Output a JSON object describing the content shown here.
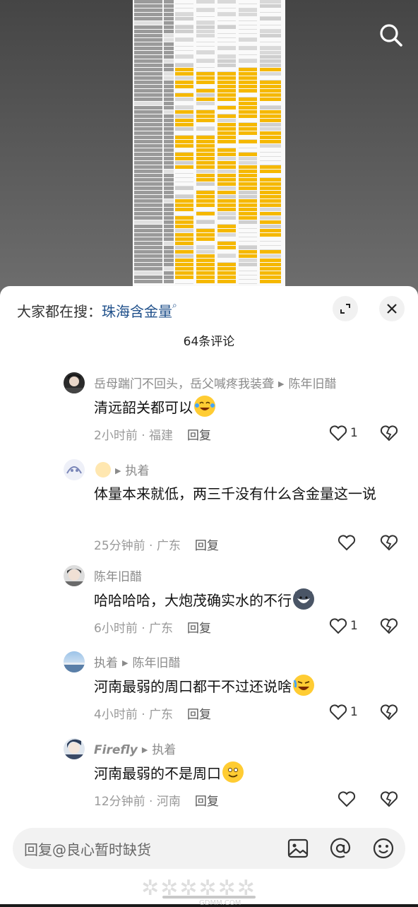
{
  "top": {
    "search_icon": "search-icon"
  },
  "sheet": {
    "trending_prefix": "大家都在搜：",
    "trending_keyword": "珠海含金量",
    "comment_count": "64条评论",
    "comments": [
      {
        "author": "岳母踹门不回头，岳父喊疼我装聋",
        "reply_to": "陈年旧醋",
        "text": "清远韶关都可以",
        "emoji": "laugh-tear-emoji",
        "time_loc": "2小时前 · 福建",
        "reply": "回复",
        "likes": "1"
      },
      {
        "author": "",
        "reply_to": "执着",
        "text": "体量本来就低，两三千没有什么含金量这一说",
        "emoji": "",
        "time_loc": "25分钟前 · 广东",
        "reply": "回复",
        "likes": ""
      },
      {
        "author": "陈年旧醋",
        "reply_to": "",
        "text": "哈哈哈哈，大炮茂确实水的不行",
        "emoji": "husky-emoji",
        "time_loc": "6小时前 · 广东",
        "reply": "回复",
        "likes": "1"
      },
      {
        "author": "执着",
        "reply_to": "陈年旧醋",
        "text": "河南最弱的周口都干不过还说啥",
        "emoji": "rofl-emoji",
        "time_loc": "4小时前 · 广东",
        "reply": "回复",
        "likes": "1"
      },
      {
        "author": "Firefly",
        "reply_to": "执着",
        "text": "河南最弱的不是周口",
        "emoji": "smile-emoji",
        "time_loc": "12分钟前 · 河南",
        "reply": "回复",
        "likes": ""
      }
    ],
    "input_placeholder": "回复@良心暂时缺货"
  },
  "watermark": {
    "text": "GDMM.COM"
  },
  "colors": {
    "keyword": "#1e4f8a",
    "highlight_yellow": "#f5b800"
  }
}
